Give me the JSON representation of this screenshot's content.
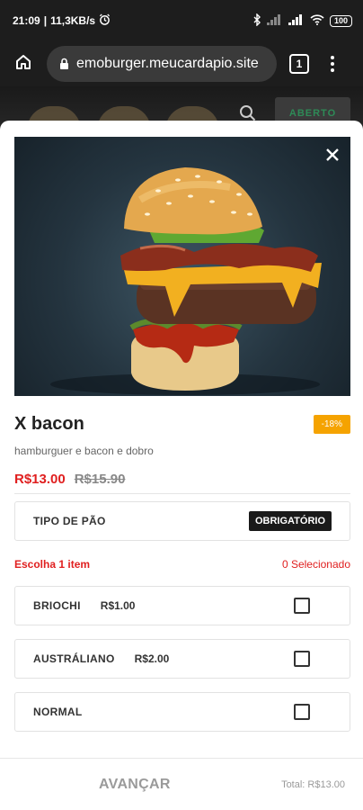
{
  "status_bar": {
    "time": "21:09",
    "speed": "11,3KB/s",
    "battery": "100"
  },
  "browser": {
    "url": "emoburger.meucardapio.site",
    "tab_count": "1"
  },
  "background": {
    "status_button": "ABERTO"
  },
  "product": {
    "name": "X bacon",
    "discount_badge": "-18%",
    "description": "hamburguer e bacon e dobro",
    "price": "R$13.00",
    "old_price": "R$15.90"
  },
  "option_group": {
    "title": "TIPO DE PÃO",
    "required_label": "OBRIGATÓRIO",
    "instruction": "Escolha 1 item",
    "selected_count": "0 Selecionado",
    "options": [
      {
        "name": "BRIOCHI",
        "price": "R$1.00",
        "checked": false
      },
      {
        "name": "AUSTRÁLIANO",
        "price": "R$2.00",
        "checked": false
      },
      {
        "name": "NORMAL",
        "price": "",
        "checked": false
      }
    ]
  },
  "footer": {
    "advance_label": "AVANÇAR",
    "total": "Total: R$13.00"
  },
  "colors": {
    "accent_red": "#e02020",
    "discount_orange": "#f5a300",
    "status_green": "#2e8b57"
  },
  "icons": [
    "alarm-icon",
    "bluetooth-icon",
    "signal-icon",
    "wifi-icon",
    "battery-icon",
    "home-icon",
    "lock-icon",
    "tabs-icon",
    "menu-icon",
    "search-icon",
    "close-icon"
  ]
}
